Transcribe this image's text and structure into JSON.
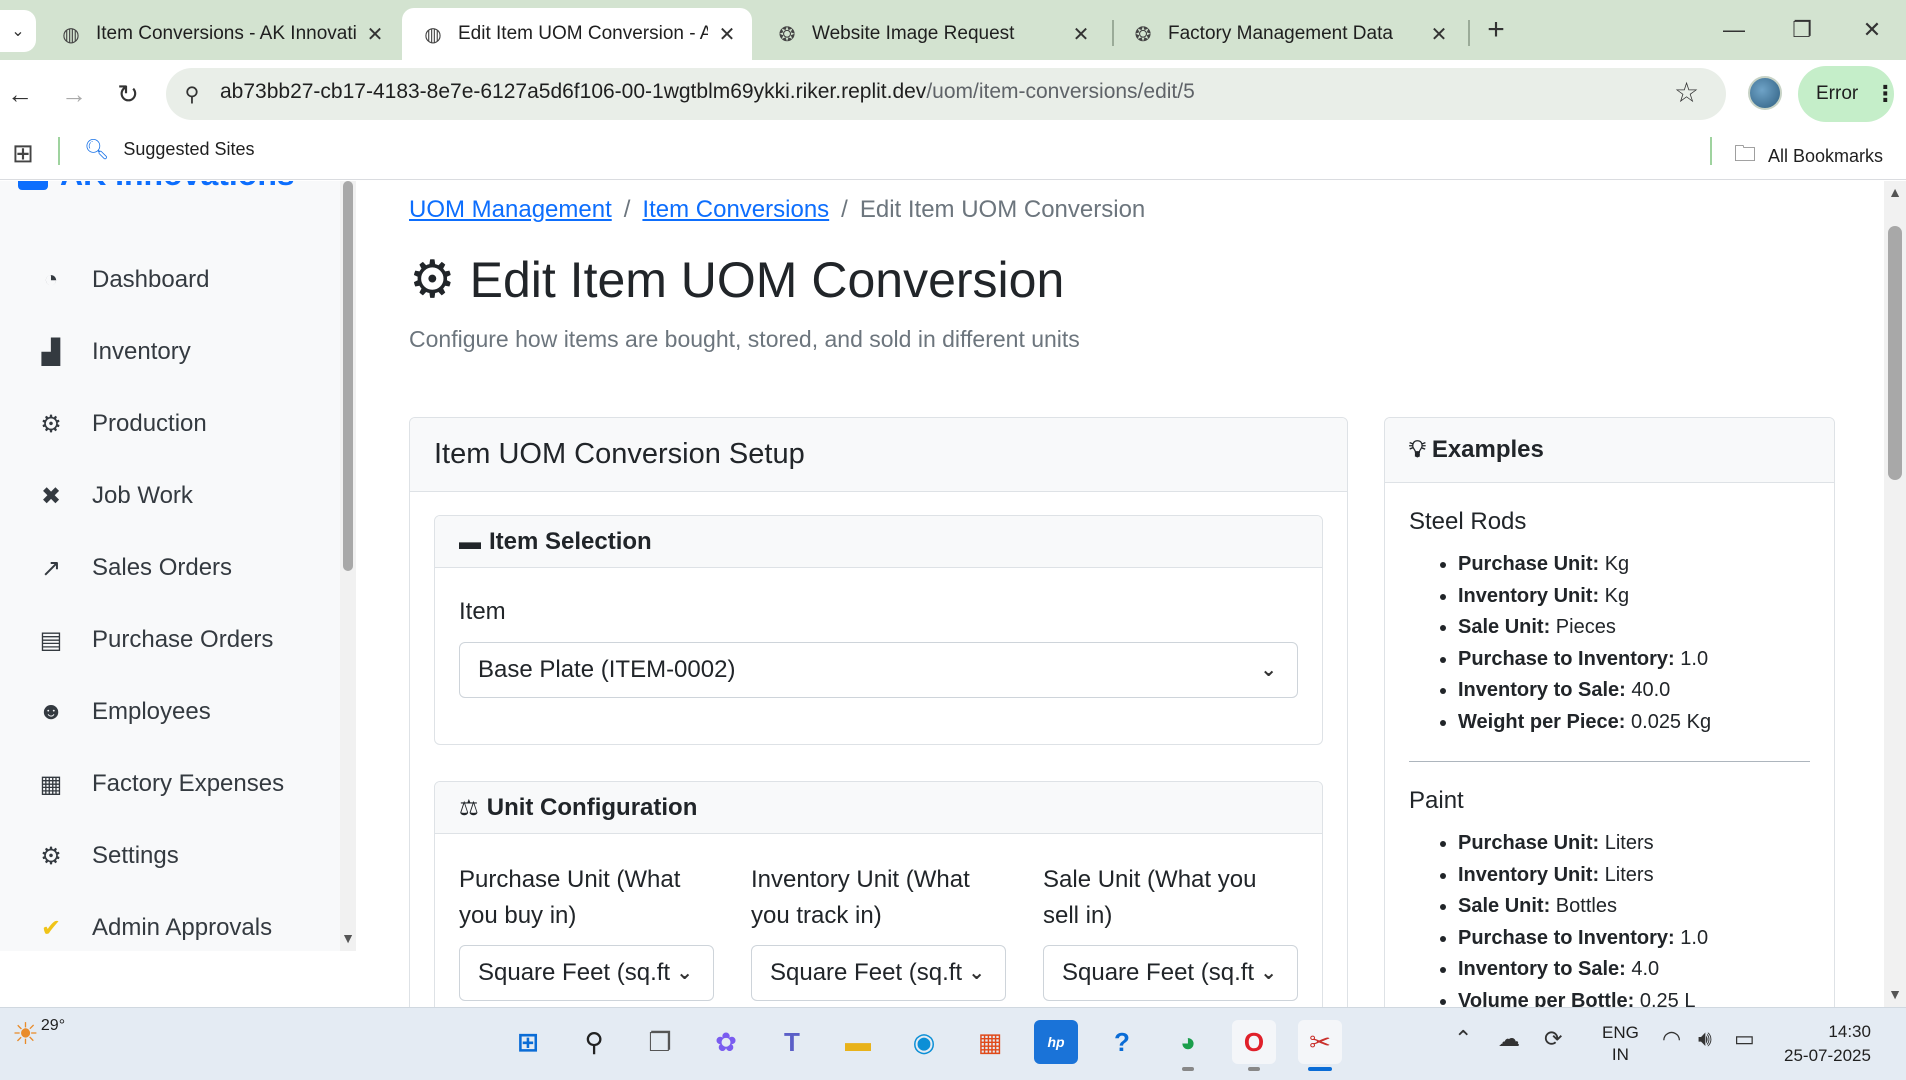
{
  "browser": {
    "tabs": [
      {
        "title": "Item Conversions - AK Innovatic",
        "icon": "globe-icon",
        "active": false
      },
      {
        "title": "Edit Item UOM Conversion - AK",
        "icon": "globe-icon",
        "active": true
      },
      {
        "title": "Website Image Request",
        "icon": "openai-icon",
        "active": false
      },
      {
        "title": "Factory Management Data",
        "icon": "openai-icon",
        "active": false
      }
    ],
    "url_host": "ab73bb27-cb17-4183-8e7e-6127a5d6f106-00-1wgtblm69ykki.riker.replit.dev",
    "url_path": "/uom/item-conversions/edit/5",
    "error_label": "Error",
    "bookmarks": {
      "suggested": "Suggested Sites",
      "all": "All Bookmarks"
    }
  },
  "sidebar": {
    "brand": "AK Innovations",
    "items": [
      {
        "label": "Dashboard",
        "icon": "dashboard-icon",
        "glyph": "◔"
      },
      {
        "label": "Inventory",
        "icon": "boxes-icon",
        "glyph": "▟"
      },
      {
        "label": "Production",
        "icon": "gears-icon",
        "glyph": "⚙"
      },
      {
        "label": "Job Work",
        "icon": "tools-icon",
        "glyph": "✖"
      },
      {
        "label": "Sales Orders",
        "icon": "chart-line-icon",
        "glyph": "📈"
      },
      {
        "label": "Purchase Orders",
        "icon": "file-invoice-icon",
        "glyph": "▤"
      },
      {
        "label": "Employees",
        "icon": "users-icon",
        "glyph": "👥"
      },
      {
        "label": "Factory Expenses",
        "icon": "receipt-icon",
        "glyph": "▦"
      },
      {
        "label": "Settings",
        "icon": "gear-icon",
        "glyph": "⚙"
      },
      {
        "label": "Admin Approvals",
        "icon": "clipboard-check-icon",
        "glyph": "✔"
      }
    ]
  },
  "breadcrumb": {
    "items": [
      "UOM Management",
      "Item Conversions"
    ],
    "current": "Edit Item UOM Conversion",
    "separator": "/"
  },
  "page": {
    "title": "Edit Item UOM Conversion",
    "subtitle": "Configure how items are bought, stored, and sold in different units"
  },
  "form": {
    "card_title": "Item UOM Conversion Setup",
    "item_section": {
      "title": "Item Selection",
      "label": "Item",
      "value": "Base Plate (ITEM-0002)"
    },
    "unit_section": {
      "title": "Unit Configuration",
      "purchase_label": "Purchase Unit (What you buy in)",
      "purchase_value": "Square Feet (sq.ft",
      "inventory_label": "Inventory Unit (What you track in)",
      "inventory_value": "Square Feet (sq.ft",
      "sale_label": "Sale Unit (What you sell in)",
      "sale_value": "Square Feet (sq.ft"
    }
  },
  "examples": {
    "title": "Examples",
    "steel": {
      "title": "Steel Rods",
      "items": [
        {
          "key": "Purchase Unit:",
          "val": " Kg"
        },
        {
          "key": "Inventory Unit:",
          "val": " Kg"
        },
        {
          "key": "Sale Unit:",
          "val": " Pieces"
        },
        {
          "key": "Purchase to Inventory:",
          "val": " 1.0"
        },
        {
          "key": "Inventory to Sale:",
          "val": " 40.0"
        },
        {
          "key": "Weight per Piece:",
          "val": " 0.025 Kg"
        }
      ]
    },
    "paint": {
      "title": "Paint",
      "items": [
        {
          "key": "Purchase Unit:",
          "val": " Liters"
        },
        {
          "key": "Inventory Unit:",
          "val": " Liters"
        },
        {
          "key": "Sale Unit:",
          "val": " Bottles"
        },
        {
          "key": "Purchase to Inventory:",
          "val": " 1.0"
        },
        {
          "key": "Inventory to Sale:",
          "val": " 4.0"
        },
        {
          "key": "Volume per Bottle:",
          "val": " 0.25 L"
        }
      ]
    }
  },
  "taskbar": {
    "temperature": "29°",
    "lang_1": "ENG",
    "lang_2": "IN",
    "time": "14:30",
    "date": "25-07-2025"
  },
  "colors": {
    "accent": "#0d6efd",
    "chrome_tabstrip": "#d3e3d0",
    "error_pill": "#c5eec9"
  }
}
